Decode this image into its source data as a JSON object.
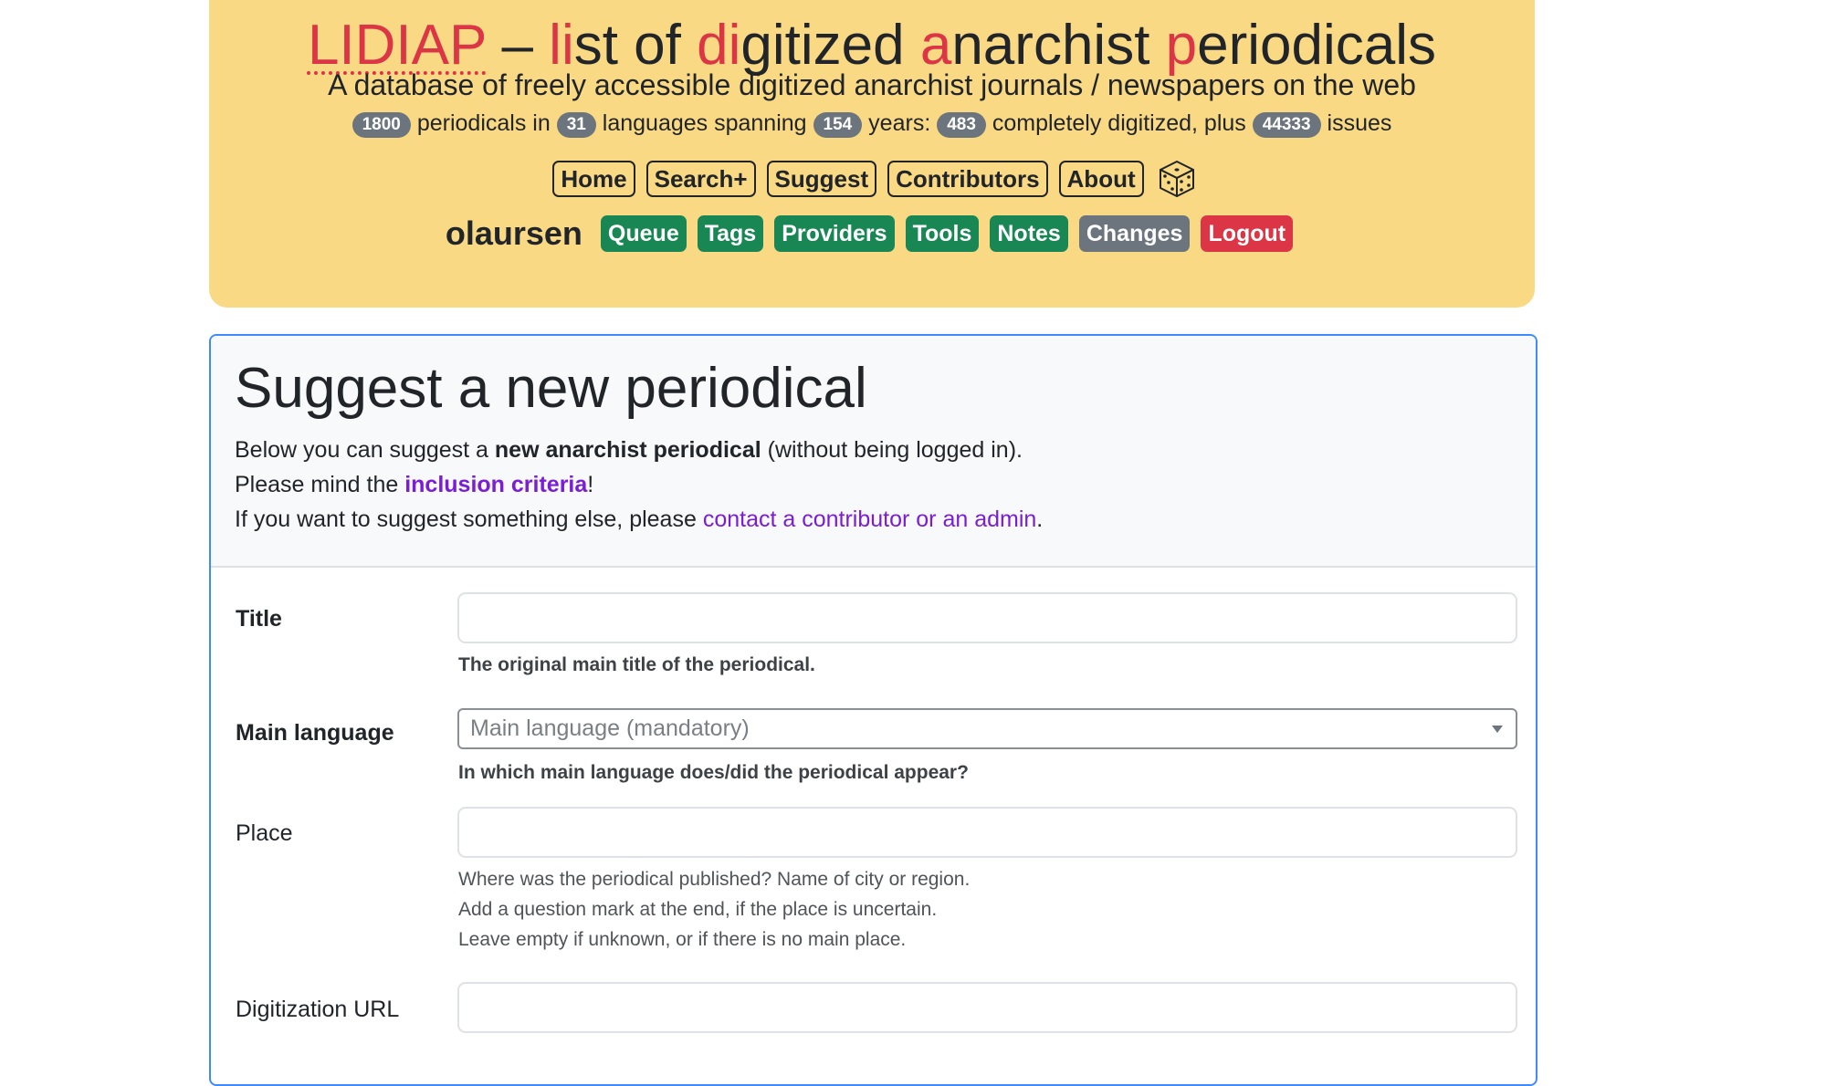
{
  "header": {
    "title_abbr": "LIDIAP",
    "title_parts": {
      "dash": " – ",
      "p1": "li",
      "p2": "st of ",
      "p3": "di",
      "p4": "gitized ",
      "p5": "a",
      "p6": "narchist ",
      "p7": "p",
      "p8": "eriodicals"
    },
    "subtitle": "A database of freely accessible digitized anarchist journals / newspapers on the web",
    "stats": {
      "periodicals_count": "1800",
      "text1": " periodicals in ",
      "languages_count": "31",
      "text2": " languages spanning ",
      "years_count": "154",
      "text3": " years: ",
      "complete_count": "483",
      "text4": " completely digitized, plus ",
      "issues_count": "44333",
      "text5": " issues"
    },
    "nav": {
      "home": "Home",
      "search": "Search+",
      "suggest": "Suggest",
      "contributors": "Contributors",
      "about": "About",
      "random_icon": "dice-icon"
    },
    "user": {
      "username": "olaursen",
      "queue": "Queue",
      "tags": "Tags",
      "providers": "Providers",
      "tools": "Tools",
      "notes": "Notes",
      "changes": "Changes",
      "logout": "Logout"
    }
  },
  "form": {
    "heading": "Suggest a new periodical",
    "intro": {
      "line1_a": "Below you can suggest a ",
      "line1_b": "new anarchist periodical",
      "line1_c": " (without being logged in).",
      "line2_a": "Please mind the ",
      "line2_link": "inclusion criteria",
      "line2_b": "!",
      "line3_a": "If you want to suggest something else, please ",
      "line3_link": "contact a contributor or an admin",
      "line3_b": "."
    },
    "title": {
      "label": "Title",
      "value": "",
      "help": "The original main title of the periodical."
    },
    "language": {
      "label": "Main language",
      "selected": "Main language (mandatory)",
      "help": "In which main language does/did the periodical appear?"
    },
    "place": {
      "label": "Place",
      "value": "",
      "help1": "Where was the periodical published? Name of city or region.",
      "help2": "Add a question mark at the end, if the place is uncertain.",
      "help3": "Leave empty if unknown, or if there is no main place."
    },
    "url": {
      "label": "Digitization URL",
      "value": ""
    }
  },
  "colors": {
    "header_bg": "#f9d984",
    "accent_red": "#dc3545",
    "admin_green": "#198754",
    "badge_gray": "#6c757d",
    "link_purple": "#7a1dd4",
    "card_border": "#3d8bfd"
  }
}
